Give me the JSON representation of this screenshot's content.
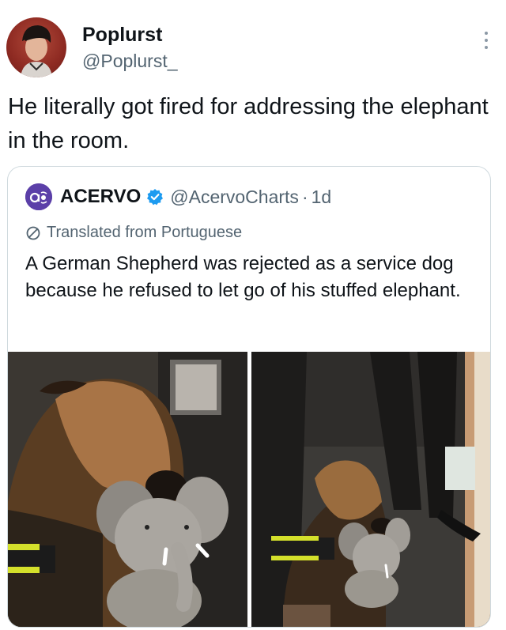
{
  "tweet": {
    "author": {
      "display_name": "Poplurst",
      "handle": "@Poplurst_",
      "avatar_icon": "user-avatar-photo"
    },
    "text": "He literally got fired for addressing the elephant in the room.",
    "more_icon": "more-vertical-icon"
  },
  "quoted_tweet": {
    "author": {
      "display_name": "ACERVO",
      "avatar_text": "a",
      "verified_icon": "verified-badge-icon",
      "handle": "@AcervoCharts",
      "separator": "·",
      "time": "1d"
    },
    "translation_note": "Translated from Portuguese",
    "translate_icon": "translate-icon",
    "text": "A German Shepherd was rejected as a service dog because he refused to let go of his stuffed elephant.",
    "media": [
      {
        "alt_icon": "dog-with-stuffed-elephant-photo"
      },
      {
        "alt_icon": "dog-with-stuffed-elephant-photo"
      }
    ]
  },
  "colors": {
    "text_primary": "#0f1419",
    "text_secondary": "#536471",
    "border": "#cfd9de",
    "verified_blue": "#1d9bf0",
    "acervo_purple": "#5b3fa8"
  }
}
